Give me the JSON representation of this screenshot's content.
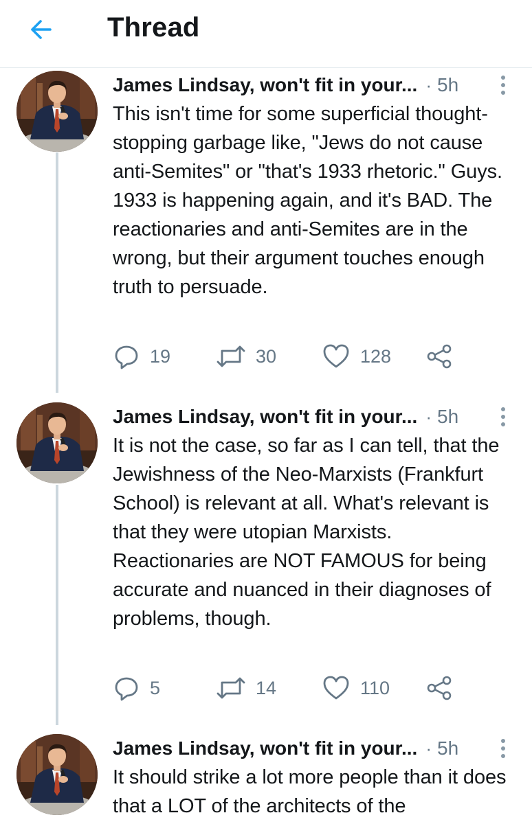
{
  "header": {
    "title": "Thread",
    "back_icon": "arrow-left-icon",
    "accent": "#1da1f2"
  },
  "tweets": [
    {
      "author": "James Lindsay, won't fit in your...",
      "separator": "·",
      "time": "5h",
      "text": "This isn't time for some superficial thought-stopping garbage like, \"Jews do not cause anti-Semites\" or \"that's 1933 rhetoric.\" Guys. 1933 is happening again, and it's BAD. The reactionaries and anti-Semites are in the wrong, but their argument touches enough truth to persuade.",
      "replies": "19",
      "retweets": "30",
      "likes": "128"
    },
    {
      "author": "James Lindsay, won't fit in your...",
      "separator": "·",
      "time": "5h",
      "text": "It is not the case, so far as I can tell, that the Jewishness of the Neo-Marxists (Frankfurt School) is relevant at all. What's relevant is that they were utopian Marxists. Reactionaries are NOT FAMOUS for being accurate and nuanced in their diagnoses of problems, though.",
      "replies": "5",
      "retweets": "14",
      "likes": "110"
    },
    {
      "author": "James Lindsay, won't fit in your...",
      "separator": "·",
      "time": "5h",
      "text": "It should strike a lot more people than it does that a LOT of the architects of the"
    }
  ]
}
